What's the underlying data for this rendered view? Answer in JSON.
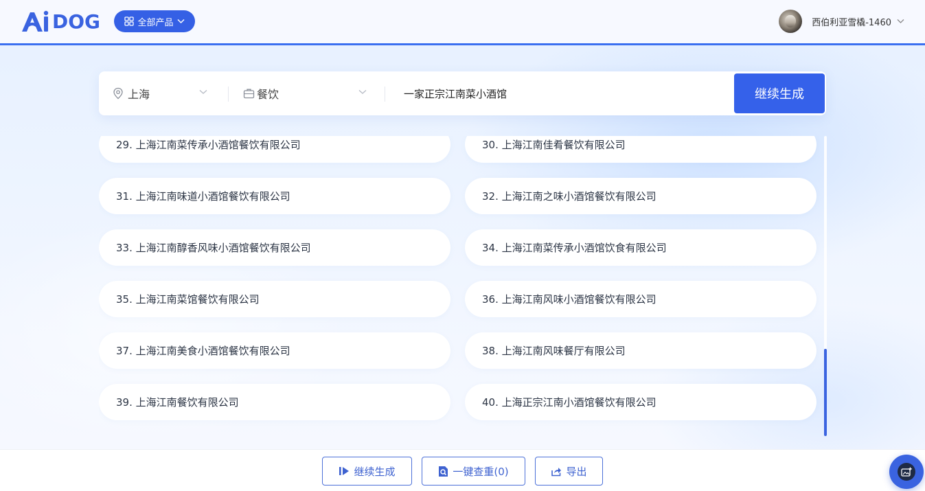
{
  "header": {
    "logo_text": "DOG",
    "products_label": "全部产品",
    "username": "西伯利亚雪橇-1460"
  },
  "search": {
    "city": "上海",
    "industry": "餐饮",
    "description": "一家正宗江南菜小酒馆",
    "generate_label": "继续生成"
  },
  "results": [
    "29. 上海江南菜传承小酒馆餐饮有限公司",
    "30. 上海江南佳肴餐饮有限公司",
    "31. 上海江南味道小酒馆餐饮有限公司",
    "32. 上海江南之味小酒馆餐饮有限公司",
    "33. 上海江南醇香风味小酒馆餐饮有限公司",
    "34. 上海江南菜传承小酒馆饮食有限公司",
    "35. 上海江南菜馆餐饮有限公司",
    "36. 上海江南风味小酒馆餐饮有限公司",
    "37. 上海江南美食小酒馆餐饮有限公司",
    "38. 上海江南风味餐厅有限公司",
    "39. 上海江南餐饮有限公司",
    "40. 上海正宗江南小酒馆餐饮有限公司"
  ],
  "footer": {
    "continue_label": "继续生成",
    "check_label": "一键查重(0)",
    "export_label": "导出"
  },
  "colors": {
    "accent": "#3561ea",
    "header_border": "#3a6ff0"
  },
  "icons": {
    "city": "location-pin-icon",
    "industry": "briefcase-icon",
    "products": "grid-icon",
    "continue": "play-next-icon",
    "check": "doc-search-icon",
    "export": "share-icon",
    "fab": "image-add-icon"
  }
}
